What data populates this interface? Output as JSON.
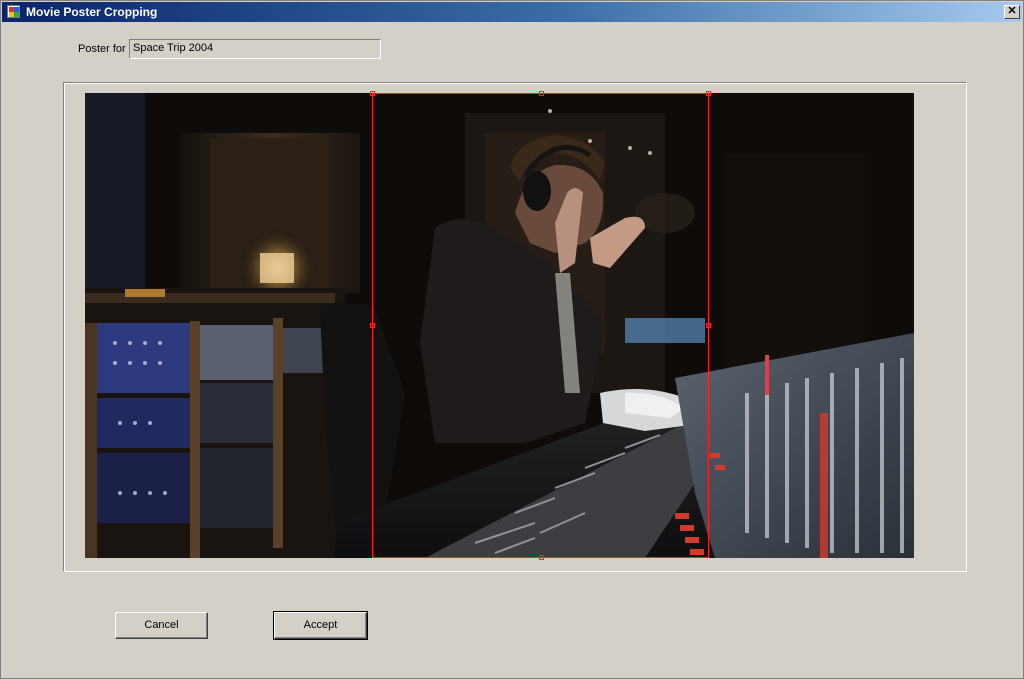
{
  "window": {
    "title": "Movie Poster Cropping",
    "close_glyph": "✕"
  },
  "poster": {
    "label": "Poster for :",
    "value": "Space Trip 2004"
  },
  "image": {
    "icon": "film-still-image",
    "description_colors": {
      "crop_border": "#ff2020",
      "background": "#100c0a"
    }
  },
  "buttons": {
    "cancel_label": "Cancel",
    "accept_label": "Accept"
  }
}
